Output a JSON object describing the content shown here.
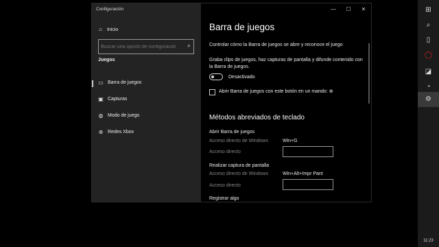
{
  "window": {
    "title": "Configuración"
  },
  "sidebar": {
    "home_label": "Inicio",
    "search_placeholder": "Buscar una opción de configuración",
    "section_title": "Juegos",
    "items": [
      {
        "label": "Barra de juegos",
        "icon": "game-bar-icon"
      },
      {
        "label": "Capturas",
        "icon": "capture-icon"
      },
      {
        "label": "Modo de juego",
        "icon": "game-mode-icon"
      },
      {
        "label": "Redes Xbox",
        "icon": "xbox-icon"
      }
    ]
  },
  "main": {
    "title": "Barra de juegos",
    "intro": "Controlar cómo la Barra de juegos se abre y reconoce el juego",
    "description": "Graba clips de juegos, haz capturas de pantalla y difunde contenido con la Barra de juegos.",
    "toggle_state": "Desactivado",
    "checkbox_label": "Abrir Barra de juegos con este botón en un mando:",
    "shortcuts_heading": "Métodos abreviados de teclado",
    "shortcut_groups": [
      {
        "title": "Abrir Barra de juegos",
        "windows_label": "Acceso directo de Windows",
        "windows_value": "Win+G",
        "custom_label": "Acceso directo"
      },
      {
        "title": "Realizar captura de pantalla",
        "windows_label": "Acceso directo de Windows",
        "windows_value": "Win+Alt+Impr Pant",
        "custom_label": "Acceso directo"
      }
    ],
    "next_group": "Registrar algo"
  },
  "taskbar": {
    "clock": "11:23"
  }
}
